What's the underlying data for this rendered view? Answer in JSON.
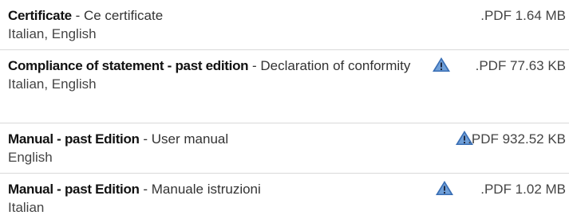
{
  "documents": [
    {
      "title": "Certificate",
      "separator": " - ",
      "description": "Ce certificate",
      "languages": "Italian, English",
      "file": ".PDF 1.64 MB",
      "warning": false
    },
    {
      "title": "Compliance of statement - past edition",
      "separator": " - ",
      "description": "Declaration of conformity",
      "languages": "Italian, English",
      "file": ".PDF 77.63 KB",
      "warning": true
    },
    {
      "title": "Manual - past Edition",
      "separator": " - ",
      "description": "User manual",
      "languages": "English",
      "file": ".PDF 932.52 KB",
      "warning": true
    },
    {
      "title": "Manual - past Edition",
      "separator": " - ",
      "description": "Manuale istruzioni",
      "languages": "Italian",
      "file": ".PDF 1.02 MB",
      "warning": true
    }
  ],
  "icons": {
    "warning_icon": "warning-triangle-icon",
    "warning_color": "#3a6fb5"
  }
}
